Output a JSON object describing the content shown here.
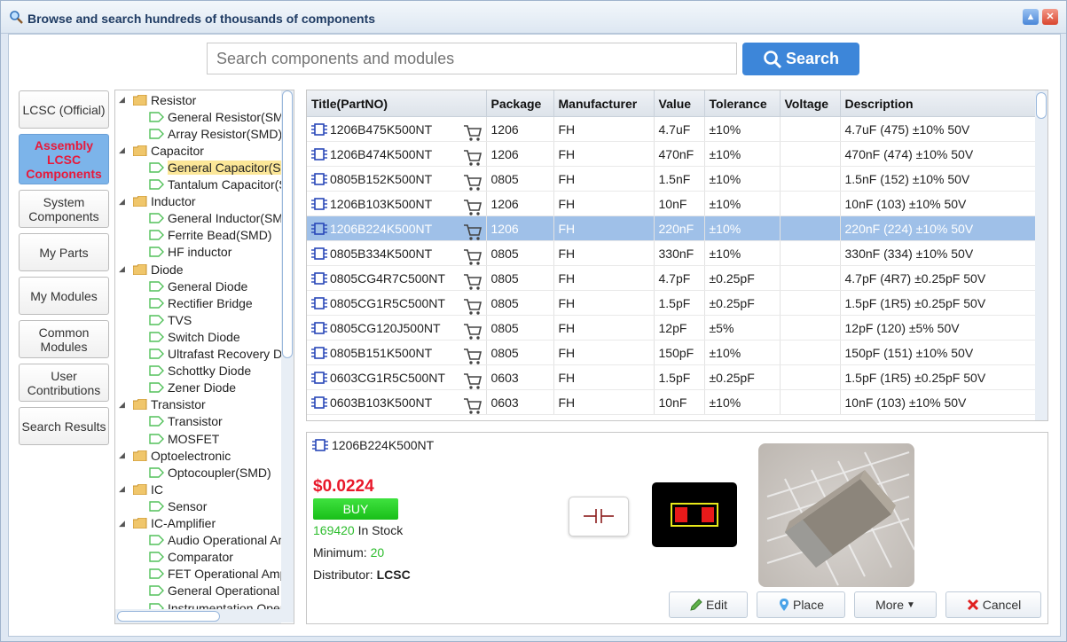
{
  "window": {
    "title": "Browse and search hundreds of thousands of components",
    "colors": {
      "accent": "#3d86d9",
      "selected_row": "#9fc0e8",
      "price": "#e8192b",
      "buy": "#22c722",
      "stock": "#2dbd2d"
    }
  },
  "search": {
    "placeholder": "Search components and modules",
    "button_label": "Search"
  },
  "categories": [
    {
      "label": "LCSC (Official)"
    },
    {
      "label": "Assembly LCSC Components",
      "active": true
    },
    {
      "label": "System Components"
    },
    {
      "label": "My Parts"
    },
    {
      "label": "My Modules"
    },
    {
      "label": "Common Modules"
    },
    {
      "label": "User Contributions"
    },
    {
      "label": "Search Results"
    }
  ],
  "tree": [
    {
      "label": "Resistor",
      "level": 0
    },
    {
      "label": "General Resistor(SMD)",
      "level": 1
    },
    {
      "label": "Array Resistor(SMD)",
      "level": 1
    },
    {
      "label": "Capacitor",
      "level": 0
    },
    {
      "label": "General Capacitor(SMD)",
      "level": 1,
      "selected": true
    },
    {
      "label": "Tantalum Capacitor(SMD)",
      "level": 1
    },
    {
      "label": "Inductor",
      "level": 0
    },
    {
      "label": "General Inductor(SMD)",
      "level": 1
    },
    {
      "label": "Ferrite Bead(SMD)",
      "level": 1
    },
    {
      "label": "HF inductor",
      "level": 1
    },
    {
      "label": "Diode",
      "level": 0
    },
    {
      "label": "General Diode",
      "level": 1
    },
    {
      "label": "Rectifier Bridge",
      "level": 1
    },
    {
      "label": "TVS",
      "level": 1
    },
    {
      "label": "Switch Diode",
      "level": 1
    },
    {
      "label": "Ultrafast Recovery Diode",
      "level": 1
    },
    {
      "label": "Schottky Diode",
      "level": 1
    },
    {
      "label": "Zener Diode",
      "level": 1
    },
    {
      "label": "Transistor",
      "level": 0
    },
    {
      "label": "Transistor",
      "level": 1
    },
    {
      "label": "MOSFET",
      "level": 1
    },
    {
      "label": "Optoelectronic",
      "level": 0
    },
    {
      "label": "Optocoupler(SMD)",
      "level": 1
    },
    {
      "label": "IC",
      "level": 0
    },
    {
      "label": "Sensor",
      "level": 1
    },
    {
      "label": "IC-Amplifier",
      "level": 0
    },
    {
      "label": "Audio Operational Amplifier",
      "level": 1
    },
    {
      "label": "Comparator",
      "level": 1
    },
    {
      "label": "FET Operational Amplifier",
      "level": 1
    },
    {
      "label": "General Operational Amplifier",
      "level": 1
    },
    {
      "label": "Instrumentation Operational Amplifier",
      "level": 1
    }
  ],
  "table": {
    "headers": [
      "Title(PartNO)",
      "Package",
      "Manufacturer",
      "Value",
      "Tolerance",
      "Voltage",
      "Description"
    ],
    "rows": [
      {
        "part": "1206B475K500NT",
        "package": "1206",
        "manufacturer": "FH",
        "value": "4.7uF",
        "tolerance": "±10%",
        "voltage": "",
        "description": "4.7uF (475) ±10% 50V"
      },
      {
        "part": "1206B474K500NT",
        "package": "1206",
        "manufacturer": "FH",
        "value": "470nF",
        "tolerance": "±10%",
        "voltage": "",
        "description": "470nF (474) ±10% 50V"
      },
      {
        "part": "0805B152K500NT",
        "package": "0805",
        "manufacturer": "FH",
        "value": "1.5nF",
        "tolerance": "±10%",
        "voltage": "",
        "description": "1.5nF (152) ±10% 50V"
      },
      {
        "part": "1206B103K500NT",
        "package": "1206",
        "manufacturer": "FH",
        "value": "10nF",
        "tolerance": "±10%",
        "voltage": "",
        "description": "10nF (103) ±10% 50V"
      },
      {
        "part": "1206B224K500NT",
        "package": "1206",
        "manufacturer": "FH",
        "value": "220nF",
        "tolerance": "±10%",
        "voltage": "",
        "description": "220nF (224) ±10% 50V",
        "selected": true
      },
      {
        "part": "0805B334K500NT",
        "package": "0805",
        "manufacturer": "FH",
        "value": "330nF",
        "tolerance": "±10%",
        "voltage": "",
        "description": "330nF (334) ±10% 50V"
      },
      {
        "part": "0805CG4R7C500NT",
        "package": "0805",
        "manufacturer": "FH",
        "value": "4.7pF",
        "tolerance": "±0.25pF",
        "voltage": "",
        "description": "4.7pF (4R7) ±0.25pF 50V"
      },
      {
        "part": "0805CG1R5C500NT",
        "package": "0805",
        "manufacturer": "FH",
        "value": "1.5pF",
        "tolerance": "±0.25pF",
        "voltage": "",
        "description": "1.5pF (1R5) ±0.25pF 50V"
      },
      {
        "part": "0805CG120J500NT",
        "package": "0805",
        "manufacturer": "FH",
        "value": "12pF",
        "tolerance": "±5%",
        "voltage": "",
        "description": "12pF (120) ±5% 50V"
      },
      {
        "part": "0805B151K500NT",
        "package": "0805",
        "manufacturer": "FH",
        "value": "150pF",
        "tolerance": "±10%",
        "voltage": "",
        "description": "150pF (151) ±10% 50V"
      },
      {
        "part": "0603CG1R5C500NT",
        "package": "0603",
        "manufacturer": "FH",
        "value": "1.5pF",
        "tolerance": "±0.25pF",
        "voltage": "",
        "description": "1.5pF (1R5) ±0.25pF 50V"
      },
      {
        "part": "0603B103K500NT",
        "package": "0603",
        "manufacturer": "FH",
        "value": "10nF",
        "tolerance": "±10%",
        "voltage": "",
        "description": "10nF (103) ±10% 50V"
      }
    ]
  },
  "detail": {
    "part": "1206B224K500NT",
    "price": "$0.0224",
    "buy_label": "BUY",
    "stock_count": "169420",
    "stock_label": "In Stock",
    "minimum_label": "Minimum:",
    "minimum_value": "20",
    "distributor_label": "Distributor:",
    "distributor_value": "LCSC"
  },
  "actions": {
    "edit": "Edit",
    "place": "Place",
    "more": "More",
    "cancel": "Cancel"
  }
}
